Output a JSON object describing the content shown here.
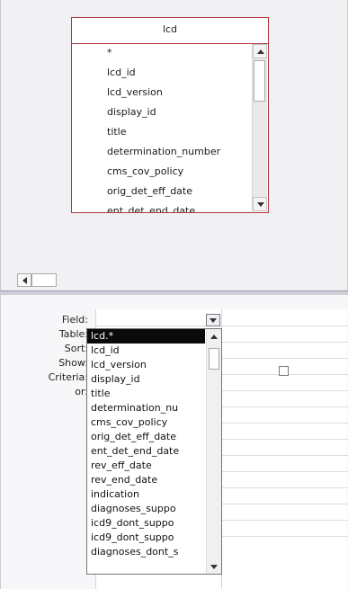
{
  "table_box": {
    "title": "lcd",
    "fields": [
      "*",
      "lcd_id",
      "lcd_version",
      "display_id",
      "title",
      "determination_number",
      "cms_cov_policy",
      "orig_det_eff_date",
      "ent_det_end_date"
    ]
  },
  "grid": {
    "row_labels": {
      "field": "Field:",
      "table": "Table:",
      "sort": "Sort:",
      "show": "Show:",
      "criteria": "Criteria:",
      "or": "or:"
    },
    "show_checked": false
  },
  "field_dropdown": {
    "selected": "lcd.*",
    "options": [
      "lcd.*",
      "lcd_id",
      "lcd_version",
      "display_id",
      "title",
      "determination_nu",
      "cms_cov_policy",
      "orig_det_eff_date",
      "ent_det_end_date",
      "rev_eff_date",
      "rev_end_date",
      "indication",
      "diagnoses_suppo",
      "icd9_dont_suppo",
      "icd9_dont_suppo",
      "diagnoses_dont_s"
    ]
  },
  "colors": {
    "table_border": "#b3343c",
    "selection": "#0a0a0a",
    "pane_bg": "#f1f1f4"
  }
}
